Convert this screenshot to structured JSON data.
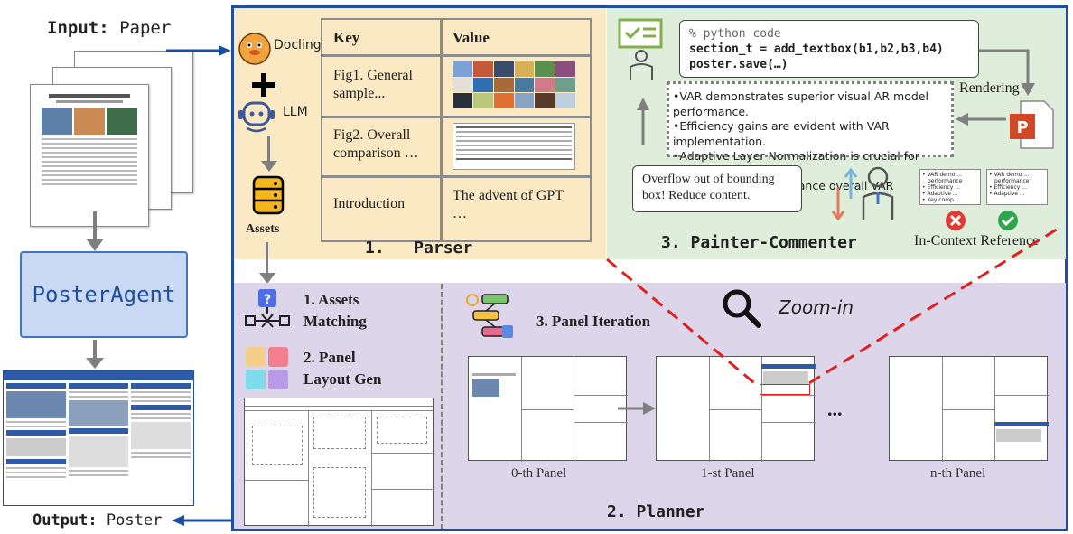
{
  "left": {
    "input_prefix": "Input:",
    "input_value": "Paper",
    "agent": "PosterAgent",
    "output_prefix": "Output:",
    "output_value": "Poster"
  },
  "parser": {
    "docling": "Docling",
    "llm": "LLM",
    "assets": "Assets",
    "title": "1.   Parser",
    "table": {
      "headers": [
        "Key",
        "Value"
      ],
      "rows": [
        {
          "key": "Fig1. General sample...",
          "value": ""
        },
        {
          "key": "Fig2. Overall comparison …",
          "value": ""
        },
        {
          "key": "Introduction",
          "value": "The advent of GPT …"
        }
      ]
    }
  },
  "painter": {
    "code_comment": "% python code",
    "code_line1": "section_t = add_textbox(b1,b2,b3,b4)",
    "code_line2": "poster.save(…)",
    "rendering": "Rendering",
    "bullets": [
      "•VAR demonstrates superior visual AR model performance.",
      "•Efficiency gains are evident with VAR implementation.",
      "•Adaptive Layer Normalization is crucial for efficiency.",
      "•Key components enhance overall VAR effectiveness."
    ],
    "overflow": "Overflow out of bounding box! Reduce content.",
    "title": "3. Painter-Commenter",
    "reference": "In-Context Reference",
    "ref_card_a": [
      "• VAR demo ...",
      "performance",
      "• Efficiency ...",
      "• Adaptive ...",
      "• Key comp..."
    ],
    "ref_card_b": [
      "• VAR demo ...",
      "performance",
      "• Efficiency ...",
      "• Adaptive ..."
    ]
  },
  "planner": {
    "assets_matching": [
      "1. Assets",
      "Matching"
    ],
    "layout_gen": [
      "2. Panel",
      "Layout Gen"
    ],
    "panel_iteration": "3. Panel Iteration",
    "zoom": "Zoom-in",
    "panels": [
      "0-th Panel",
      "1-st Panel",
      "n-th Panel"
    ],
    "ellipsis": "...",
    "title": "2. Planner"
  },
  "colors": {
    "frame": "#1f4e9e",
    "parser_bg": "#fbe9c4",
    "painter_bg": "#dfeedb",
    "planner_bg": "#ddd6ea",
    "agent_bg": "#c9d9f4",
    "dashed_red": "#e02020"
  }
}
